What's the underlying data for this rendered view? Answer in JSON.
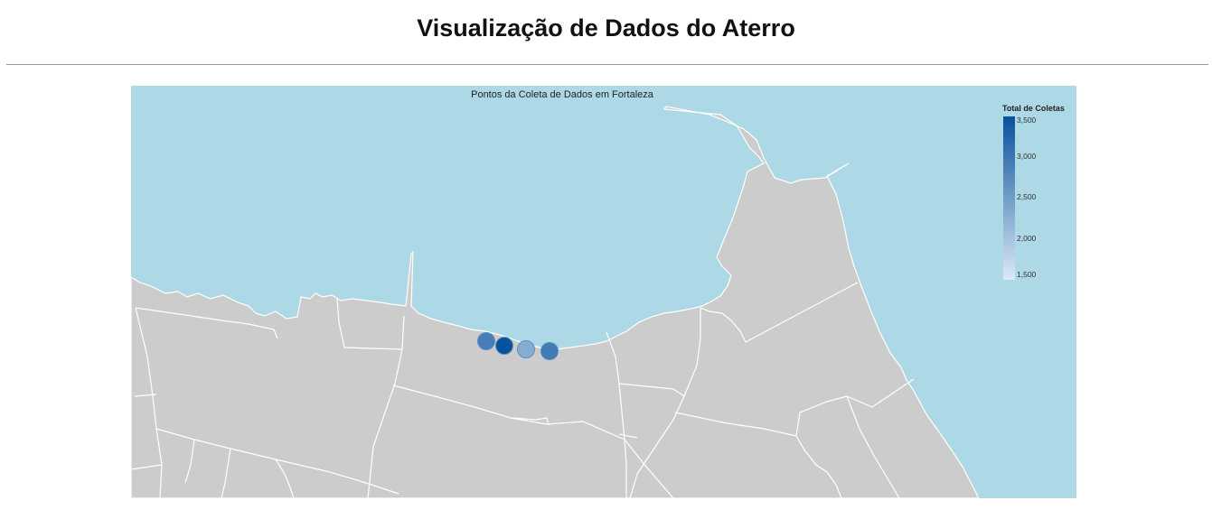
{
  "page": {
    "title": "Visualização de Dados do Aterro"
  },
  "map": {
    "title": "Pontos da Coleta de Dados em Fortaleza",
    "colors": {
      "water": "#add8e6",
      "land": "#cccccc",
      "borders": "#ffffff"
    },
    "legend": {
      "title": "Total de Coletas",
      "ticks": [
        "3,500",
        "3,000",
        "2,500",
        "2,000",
        "1,500"
      ],
      "min": 1500,
      "max": 3500,
      "color_low": "#dce8f5",
      "color_high": "#08519c"
    },
    "points": [
      {
        "total_coletas": 2900
      },
      {
        "total_coletas": 3500
      },
      {
        "total_coletas": 2300
      },
      {
        "total_coletas": 2950
      }
    ]
  }
}
